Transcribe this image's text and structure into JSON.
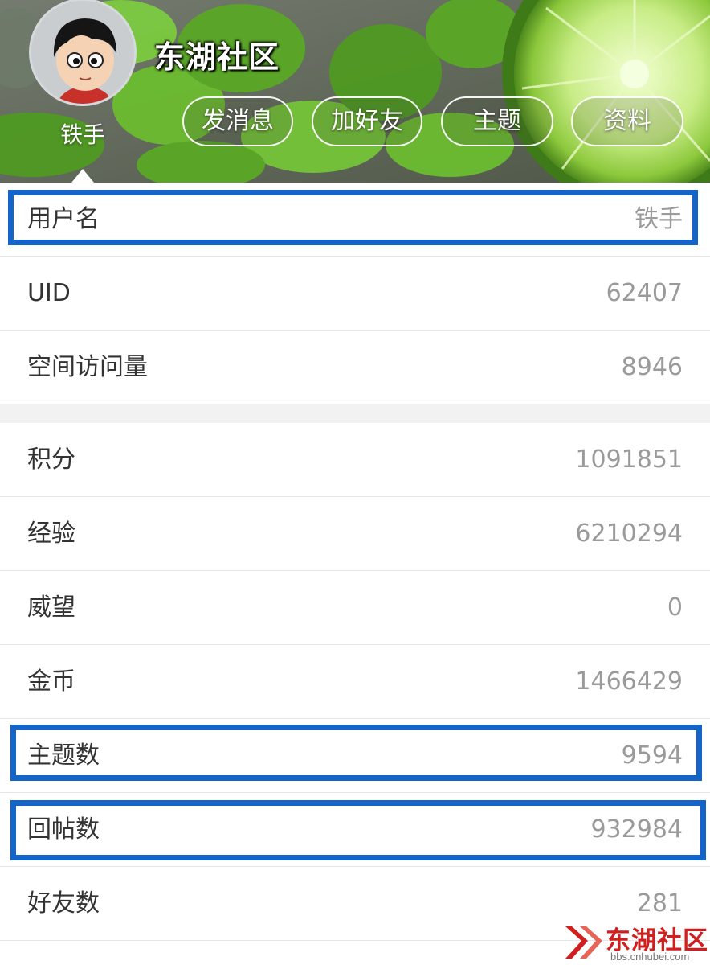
{
  "header": {
    "site_title": "东湖社区",
    "username": "铁手",
    "avatar_icon": "cartoon-avatar-icon",
    "actions": [
      {
        "label": "发消息"
      },
      {
        "label": "加好友"
      },
      {
        "label": "主题"
      },
      {
        "label": "资料"
      }
    ]
  },
  "profile": {
    "rows": [
      {
        "label": "用户名",
        "value": "铁手"
      },
      {
        "label": "UID",
        "value": "62407"
      },
      {
        "label": "空间访问量",
        "value": "8946"
      },
      {
        "label": "积分",
        "value": "1091851"
      },
      {
        "label": "经验",
        "value": "6210294"
      },
      {
        "label": "威望",
        "value": "0"
      },
      {
        "label": "金币",
        "value": "1466429"
      },
      {
        "label": "主题数",
        "value": "9594"
      },
      {
        "label": "回帖数",
        "value": "932984"
      },
      {
        "label": "好友数",
        "value": "281"
      }
    ]
  },
  "watermark": {
    "text": "东湖社区",
    "url": "bbs.cnhubei.com"
  },
  "colors": {
    "highlight_box": "#1565c8",
    "value_text": "#9a9a9a",
    "label_text": "#333333",
    "watermark_red": "#d11f1f"
  }
}
